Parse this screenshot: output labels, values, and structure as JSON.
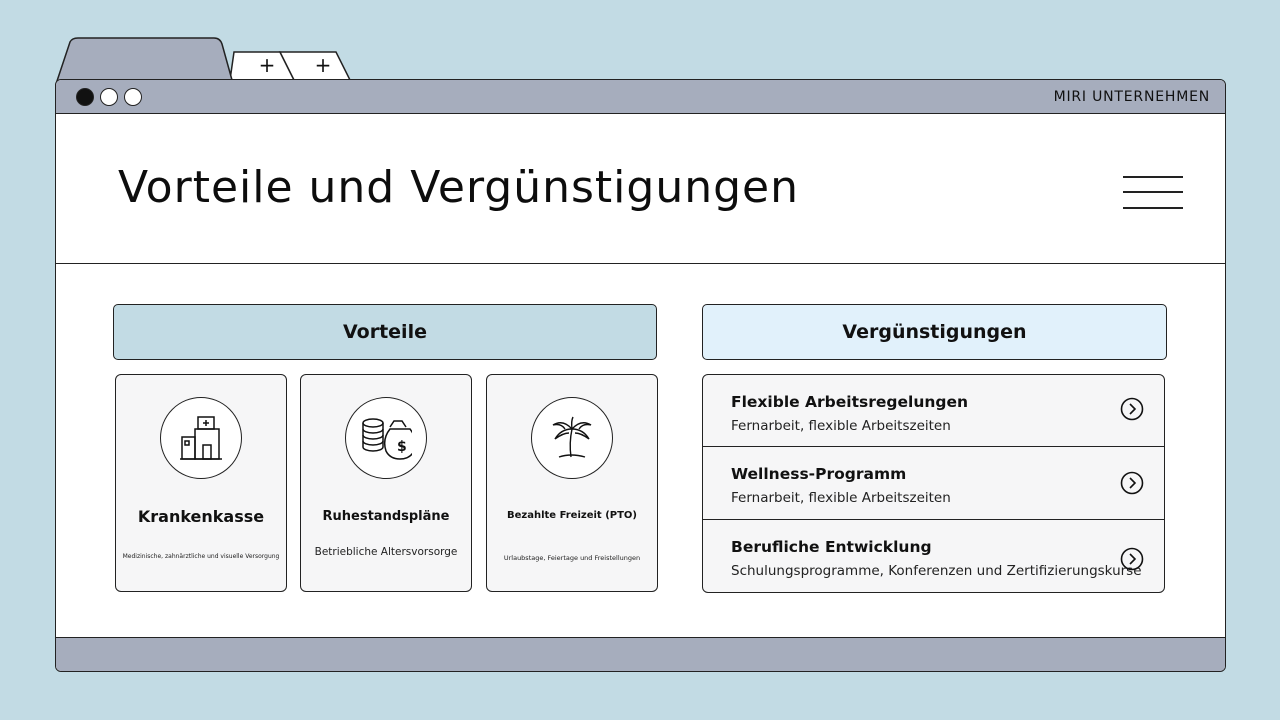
{
  "browser": {
    "company": "MIRI UNTERNEHMEN",
    "new_tab_label": "+"
  },
  "header": {
    "title": "Vorteile und Vergünstigungen"
  },
  "sections": {
    "benefits_label": "Vorteile",
    "perks_label": "Vergünstigungen"
  },
  "benefits": [
    {
      "icon": "hospital-icon",
      "title": "Krankenkasse",
      "subtitle": "Medizinische, zahnärztliche und visuelle Versorgung"
    },
    {
      "icon": "money-icon",
      "title": "Ruhestandspläne",
      "subtitle": "Betriebliche Altersvorsorge"
    },
    {
      "icon": "palm-tree-icon",
      "title": "Bezahlte Freizeit (PTO)",
      "subtitle": "Urlaubstage, Feiertage und Freistellungen"
    }
  ],
  "perks": [
    {
      "title": "Flexible Arbeitsregelungen",
      "description": "Fernarbeit, flexible Arbeitszeiten"
    },
    {
      "title": "Wellness-Programm",
      "description": "Fernarbeit, flexible Arbeitszeiten"
    },
    {
      "title": "Berufliche Entwicklung",
      "description": "Schulungsprogramme, Konferenzen und Zertifizierungskurse"
    }
  ],
  "colors": {
    "background": "#c2dbe4",
    "frame": "#a6adbd",
    "benefits_header": "#c2dbe4",
    "perks_header": "#e1f1fb"
  }
}
